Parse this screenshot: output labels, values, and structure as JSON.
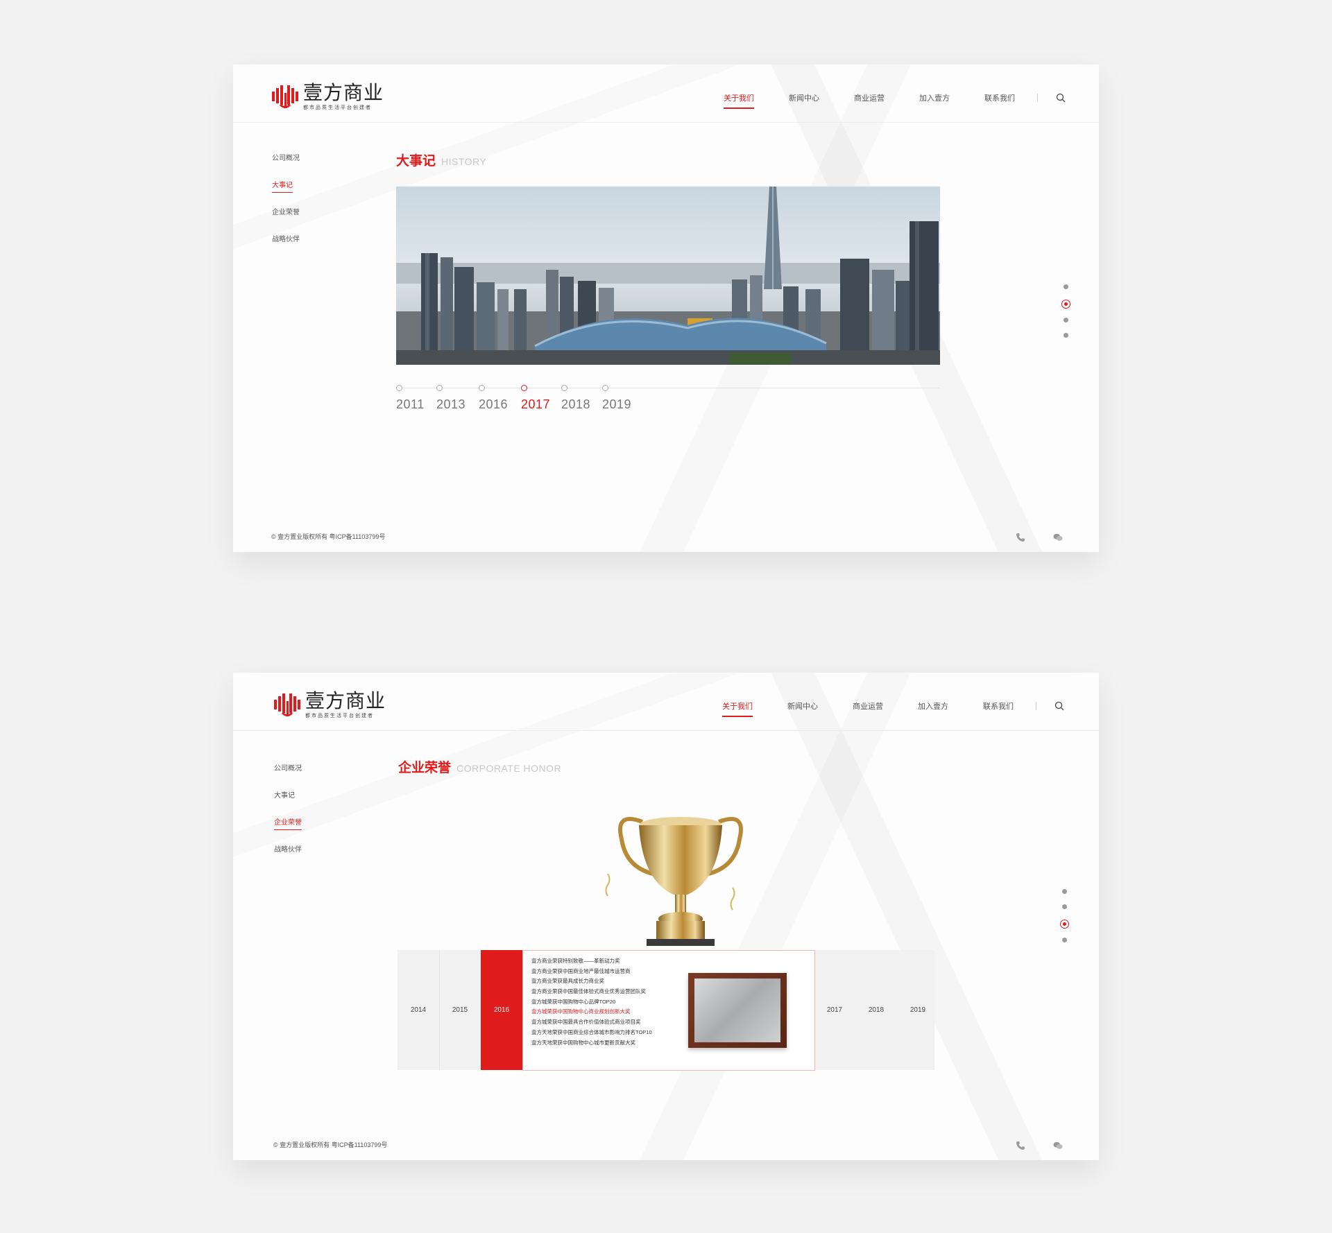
{
  "brand": {
    "name": "壹方商业",
    "tagline": "都市品质生活平台创建者",
    "accent": "#e01b1b"
  },
  "nav": {
    "items": [
      "关于我们",
      "新闻中心",
      "商业运营",
      "加入壹方",
      "联系我们"
    ],
    "active": "关于我们"
  },
  "sidebar": {
    "items": [
      "公司概况",
      "大事记",
      "企业荣誉",
      "战略伙伴"
    ]
  },
  "page1": {
    "title_cn": "大事记",
    "title_en": "HISTORY",
    "active_side": "大事记",
    "timeline": [
      "2011",
      "2013",
      "2016",
      "2017",
      "2018",
      "2019"
    ],
    "active_year": "2017",
    "page_dots": {
      "count": 4,
      "active": 2
    }
  },
  "page2": {
    "title_cn": "企业荣誉",
    "title_en": "CORPORATE HONOR",
    "active_side": "企业荣誉",
    "years_left": [
      "2014",
      "2015"
    ],
    "active_year": "2016",
    "years_right": [
      "2017",
      "2018",
      "2019"
    ],
    "honors": [
      "壹方商业荣获特别致敬——革新动力奖",
      "壹方商业荣获中国商业地产最佳城市运营商",
      "壹方商业荣获最具成长力商业奖",
      "壹方商业荣获中国最佳体验式商业优秀运营团队奖",
      "壹方城荣获中国购物中心品牌TOP20",
      "壹方城荣获中国购物中心商业规划创新大奖",
      "壹方城荣获中国最具合作价值体验式商业项目奖",
      "壹方天地荣获中国商业综合体城市影响力排名TOP10",
      "壹方天地荣获中国购物中心城市更新贡献大奖"
    ],
    "highlight_index": 5,
    "page_dots": {
      "count": 4,
      "active": 2
    }
  },
  "footer": {
    "copyright": "© 壹方置业版权所有 粤ICP备11103799号",
    "icons": [
      "phone-icon",
      "wechat-icon"
    ]
  }
}
